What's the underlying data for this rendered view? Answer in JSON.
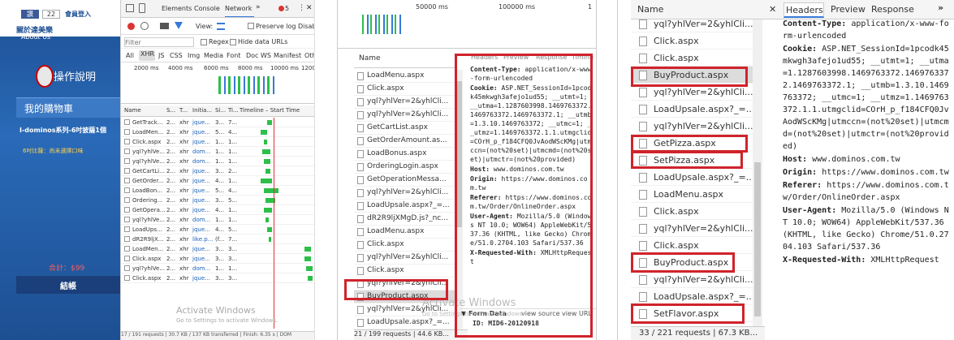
{
  "panel1": {
    "fb_like": "讚",
    "fb_count": "22",
    "member_login": "會員登入",
    "left_label": "關於達美樂",
    "about_us": "About Us",
    "help_label": "操作說明",
    "cart_title": "我的購物車",
    "cart_item": "I-dominos系列-6吋披薩1個",
    "cart_subitem": "6吋比薩：尚未選擇口味",
    "total_label": "合計：$99",
    "checkout": "結帳",
    "devtools": {
      "tabs": [
        "Elements",
        "Console",
        "Network",
        "»"
      ],
      "error_count": "5",
      "toolbar": {
        "view": "View:",
        "preserve_log": "Preserve log",
        "disable_cache": "Disab"
      },
      "filter_placeholder": "Filter",
      "regex": "Regex",
      "hide_data_urls": "Hide data URLs",
      "types": [
        "All",
        "XHR",
        "JS",
        "CSS",
        "Img",
        "Media",
        "Font",
        "Doc",
        "WS",
        "Manifest",
        "Other"
      ],
      "timeline_ticks": [
        "2000 ms",
        "4000 ms",
        "6000 ms",
        "8000 ms",
        "10000 ms",
        "1200"
      ],
      "columns": [
        "Name",
        "S...",
        "T...",
        "Initia...",
        "Si...",
        "Ti...",
        "Timeline – Start Time"
      ],
      "rows": [
        {
          "name": "GetTrack...",
          "s": "2...",
          "t": "xhr",
          "init": "jque...",
          "si": "3...",
          "ti": "7..."
        },
        {
          "name": "LoadMen...",
          "s": "2...",
          "t": "xhr",
          "init": "jque...",
          "si": "5...",
          "ti": "4..."
        },
        {
          "name": "Click.aspx",
          "s": "2...",
          "t": "xhr",
          "init": "jque...",
          "si": "1...",
          "ti": "1..."
        },
        {
          "name": "yql?yhlVe...",
          "s": "2...",
          "t": "xhr",
          "init": "dom...",
          "si": "1...",
          "ti": "1..."
        },
        {
          "name": "yql?yhlVe...",
          "s": "2...",
          "t": "xhr",
          "init": "dom...",
          "si": "1...",
          "ti": "1..."
        },
        {
          "name": "GetCartLi...",
          "s": "2...",
          "t": "xhr",
          "init": "jque...",
          "si": "3...",
          "ti": "2..."
        },
        {
          "name": "GetOrder...",
          "s": "2...",
          "t": "xhr",
          "init": "jque...",
          "si": "4...",
          "ti": "1..."
        },
        {
          "name": "LoadBon...",
          "s": "2...",
          "t": "xhr",
          "init": "jque...",
          "si": "5...",
          "ti": "4..."
        },
        {
          "name": "Ordering...",
          "s": "2...",
          "t": "xhr",
          "init": "jque...",
          "si": "3...",
          "ti": "5..."
        },
        {
          "name": "GetOpera...",
          "s": "2...",
          "t": "xhr",
          "init": "jque...",
          "si": "4...",
          "ti": "1..."
        },
        {
          "name": "yql?yhlVe...",
          "s": "2...",
          "t": "xhr",
          "init": "dom...",
          "si": "1...",
          "ti": "1..."
        },
        {
          "name": "LoadUps...",
          "s": "2...",
          "t": "xhr",
          "init": "jque...",
          "si": "4...",
          "ti": "5..."
        },
        {
          "name": "dR2R9ljX...",
          "s": "2...",
          "t": "xhr",
          "init": "like.p...",
          "si": "(f...",
          "ti": "7..."
        },
        {
          "name": "LoadMen...",
          "s": "2...",
          "t": "xhr",
          "init": "jque...",
          "si": "3...",
          "ti": "3..."
        },
        {
          "name": "Click.aspx",
          "s": "2...",
          "t": "xhr",
          "init": "jque...",
          "si": "3...",
          "ti": "3..."
        },
        {
          "name": "yql?yhlVe...",
          "s": "2...",
          "t": "xhr",
          "init": "dom...",
          "si": "1...",
          "ti": "1..."
        },
        {
          "name": "Click.aspx",
          "s": "2...",
          "t": "xhr",
          "init": "jque...",
          "si": "3...",
          "ti": "3..."
        }
      ],
      "watermark_title": "Activate Windows",
      "watermark_sub": "Go to Settings to activate Windows.",
      "status": "17 / 191 requests | 30.7 KB / 137 KB transferred | Finish: 6.35 s | DOM"
    }
  },
  "panel2": {
    "ticks": [
      "50000 ms",
      "100000 ms",
      "1"
    ],
    "name_header": "Name",
    "tabs": [
      "Headers",
      "Preview",
      "Response",
      "Timing"
    ],
    "rows": [
      "LoadMenu.aspx",
      "Click.aspx",
      "yql?yhlVer=2&yhlCli...",
      "yql?yhlVer=2&yhlCli...",
      "GetCartList.aspx",
      "GetOrderAmount.as...",
      "LoadBonus.aspx",
      "OrderingLogin.aspx",
      "GetOperationMessa...",
      "yql?yhlVer=2&yhlCli...",
      "LoadUpsale.aspx?_=...",
      "dR2R9ljXMgD.js?_nc...",
      "LoadMenu.aspx",
      "Click.aspx",
      "yql?yhlVer=2&yhlCli...",
      "Click.aspx",
      "yql?yhlVer=2&yhlCli...",
      "BuyProduct.aspx",
      "yql?yhlVer=2&yhlCli...",
      "LoadUpsale.aspx?_=..."
    ],
    "headers": [
      {
        "k": "Content-Type:",
        "v": "application/x-www-form-urlencoded"
      },
      {
        "k": "Cookie:",
        "v": "ASP.NET_SessionId=1pcodk45mkwgh3afejo1ud55; __utmt=1; __utma=1.1287603998.1469763372.1469763372.1469763372.1; __utmb=1.3.10.1469763372; __utmc=1; __utmz=1.1469763372.1.1.utmgclid=COrH_p_f184CFQ0JvAodWScKMg|utmccn=(not%20set)|utmcmd=(not%20set)|utmctr=(not%20provided)"
      },
      {
        "k": "Host:",
        "v": "www.dominos.com.tw"
      },
      {
        "k": "Origin:",
        "v": "https://www.dominos.com.tw"
      },
      {
        "k": "Referer:",
        "v": "https://www.dominos.com.tw/Order/OnlineOrder.aspx"
      },
      {
        "k": "User-Agent:",
        "v": "Mozilla/5.0 (Windows NT 10.0; WOW64) AppleWebKit/537.36 (KHTML, like Gecko) Chrome/51.0.2704.103 Safari/537.36"
      },
      {
        "k": "X-Requested-With:",
        "v": "XMLHttpRequest"
      }
    ],
    "form_data": "▼ Form Data",
    "view_source": "view source",
    "view_url": "view URL",
    "form_id": "ID: MID6-20120918",
    "watermark": "Activate Windows",
    "watermark_sub": "Go to Settings to activate Windows.",
    "status": "21 / 199 requests | 44.6 KB..."
  },
  "panel3": {
    "name_header": "Name",
    "tabs": [
      "Headers",
      "Preview",
      "Response",
      "»"
    ],
    "rows": [
      "yql?yhlVer=2&yhlCli...",
      "Click.aspx",
      "Click.aspx",
      "BuyProduct.aspx",
      "yql?yhlVer=2&yhlCli...",
      "LoadUpsale.aspx?_=...",
      "yql?yhlVer=2&yhlCli...",
      "GetPizza.aspx",
      "SetPizza.aspx",
      "LoadUpsale.aspx?_=...",
      "LoadMenu.aspx",
      "Click.aspx",
      "yql?yhlVer=2&yhlCli...",
      "Click.aspx",
      "BuyProduct.aspx",
      "yql?yhlVer=2&yhlCli...",
      "LoadUpsale.aspx?_=...",
      "SetFlavor.aspx"
    ],
    "headers": [
      {
        "k": "Content-Type:",
        "v": "application/x-www-form-urlencoded"
      },
      {
        "k": "Cookie:",
        "v": "ASP.NET_SessionId=1pcodk45mkwgh3afejo1ud55; __utmt=1; __utma=1.1287603998.1469763372.1469763372.1469763372.1; __utmb=1.3.10.1469763372; __utmc=1; __utmz=1.1469763372.1.1.utmgclid=COrH_p_f184CFQ0JvAodWScKMg|utmccn=(not%20set)|utmcmd=(not%20set)|utmctr=(not%20provided)"
      },
      {
        "k": "Host:",
        "v": "www.dominos.com.tw"
      },
      {
        "k": "Origin:",
        "v": "https://www.dominos.com.tw"
      },
      {
        "k": "Referer:",
        "v": "https://www.dominos.com.tw/Order/OnlineOrder.aspx"
      },
      {
        "k": "User-Agent:",
        "v": "Mozilla/5.0 (Windows NT 10.0; WOW64) AppleWebKit/537.36 (KHTML, like Gecko) Chrome/51.0.2704.103 Safari/537.36"
      },
      {
        "k": "X-Requested-With:",
        "v": "XMLHttpRequest"
      }
    ],
    "status": "33 / 221 requests | 67.3 KB..."
  },
  "colors": {
    "highlight": "#d0232b",
    "site_blue": "#1f4e93",
    "devtools_bg": "#f3f3f3",
    "timing_green": "#2dbf4a"
  }
}
